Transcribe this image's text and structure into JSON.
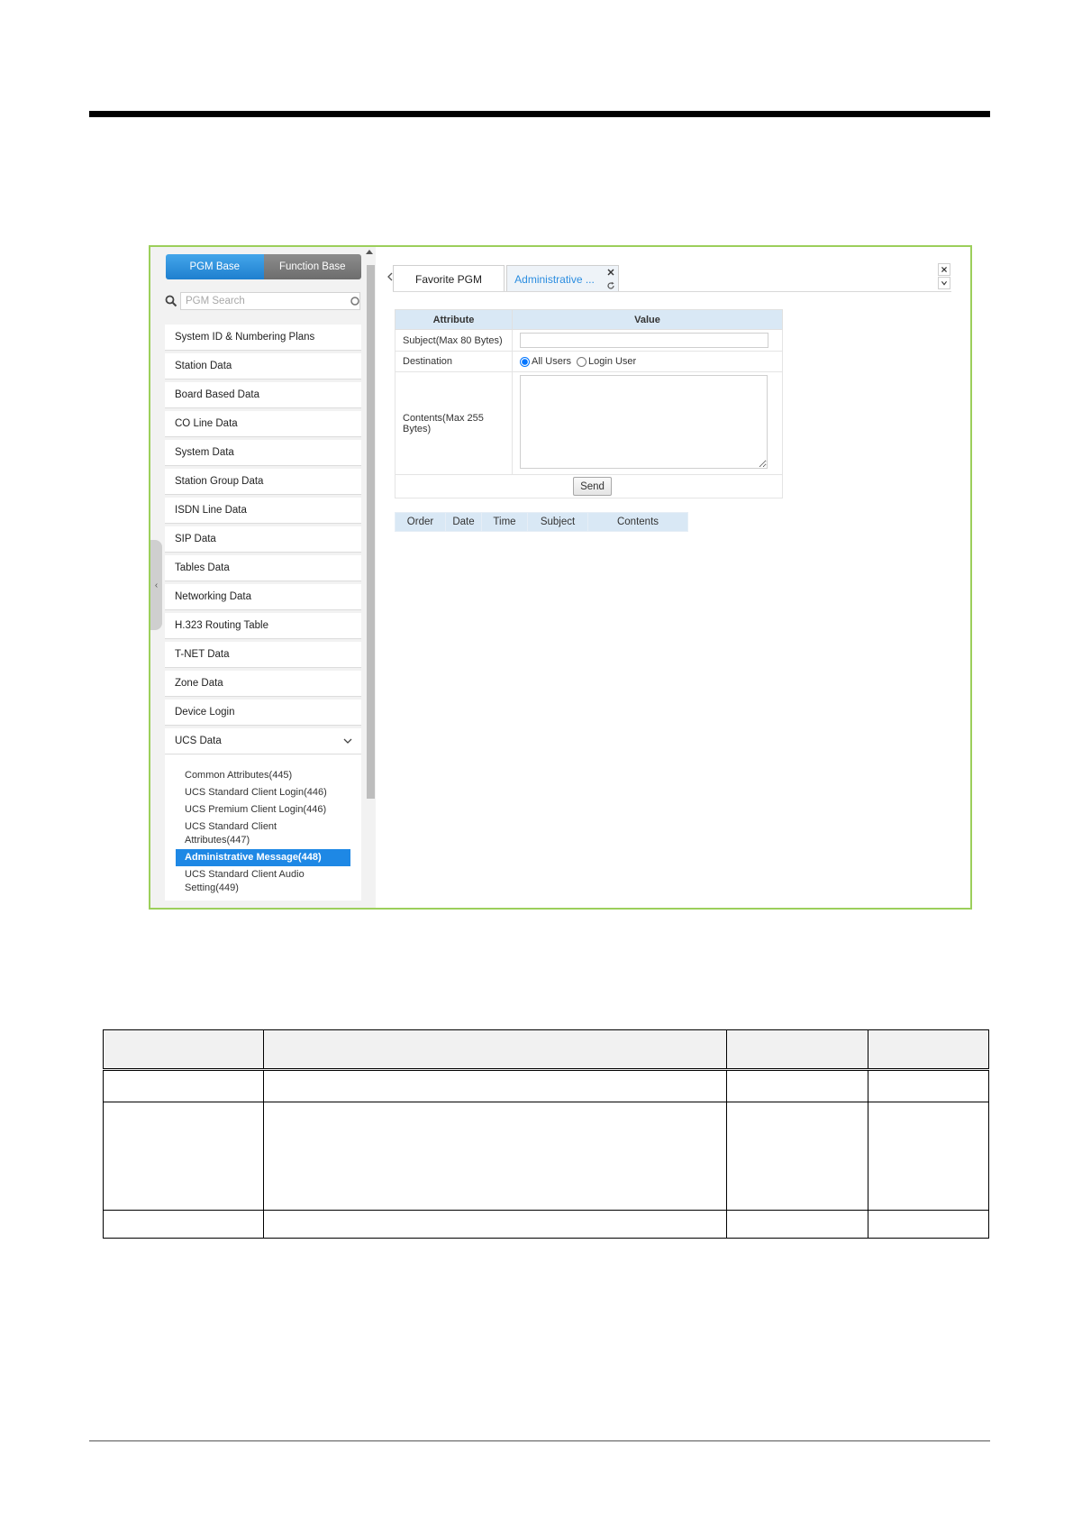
{
  "left_nav": {
    "tabs": [
      "PGM Base",
      "Function Base"
    ],
    "search_placeholder": "PGM Search",
    "items": [
      "System ID & Numbering Plans",
      "Station Data",
      "Board Based Data",
      "CO Line Data",
      "System Data",
      "Station Group Data",
      "ISDN Line Data",
      "SIP Data",
      "Tables Data",
      "Networking Data",
      "H.323 Routing Table",
      "T-NET Data",
      "Zone Data",
      "Device Login"
    ],
    "expanded_item": "UCS Data",
    "sub_items": [
      "Common Attributes(445)",
      "UCS Standard Client Login(446)",
      "UCS Premium Client Login(446)",
      "UCS Standard Client Attributes(447)",
      "Administrative Message(448)",
      "UCS Standard Client Audio Setting(449)"
    ],
    "selected_sub_item": "Administrative Message(448)"
  },
  "tabs": {
    "favorite": "Favorite PGM",
    "active": "Administrative ..."
  },
  "attr_table": {
    "headers": [
      "Attribute",
      "Value"
    ],
    "subject_label": "Subject(Max 80 Bytes)",
    "subject_value": "",
    "destination_label": "Destination",
    "destination_options": [
      "All Users",
      "Login User"
    ],
    "destination_selected": "All Users",
    "contents_label": "Contents(Max 255 Bytes)",
    "contents_value": "",
    "send_label": "Send"
  },
  "message_table": {
    "headers": [
      "Order",
      "Date",
      "Time",
      "Subject",
      "Contents"
    ]
  },
  "colors": {
    "frame_border": "#9ccf5b",
    "accent_blue": "#1e88e5",
    "header_blue": "#d9e8f5"
  }
}
